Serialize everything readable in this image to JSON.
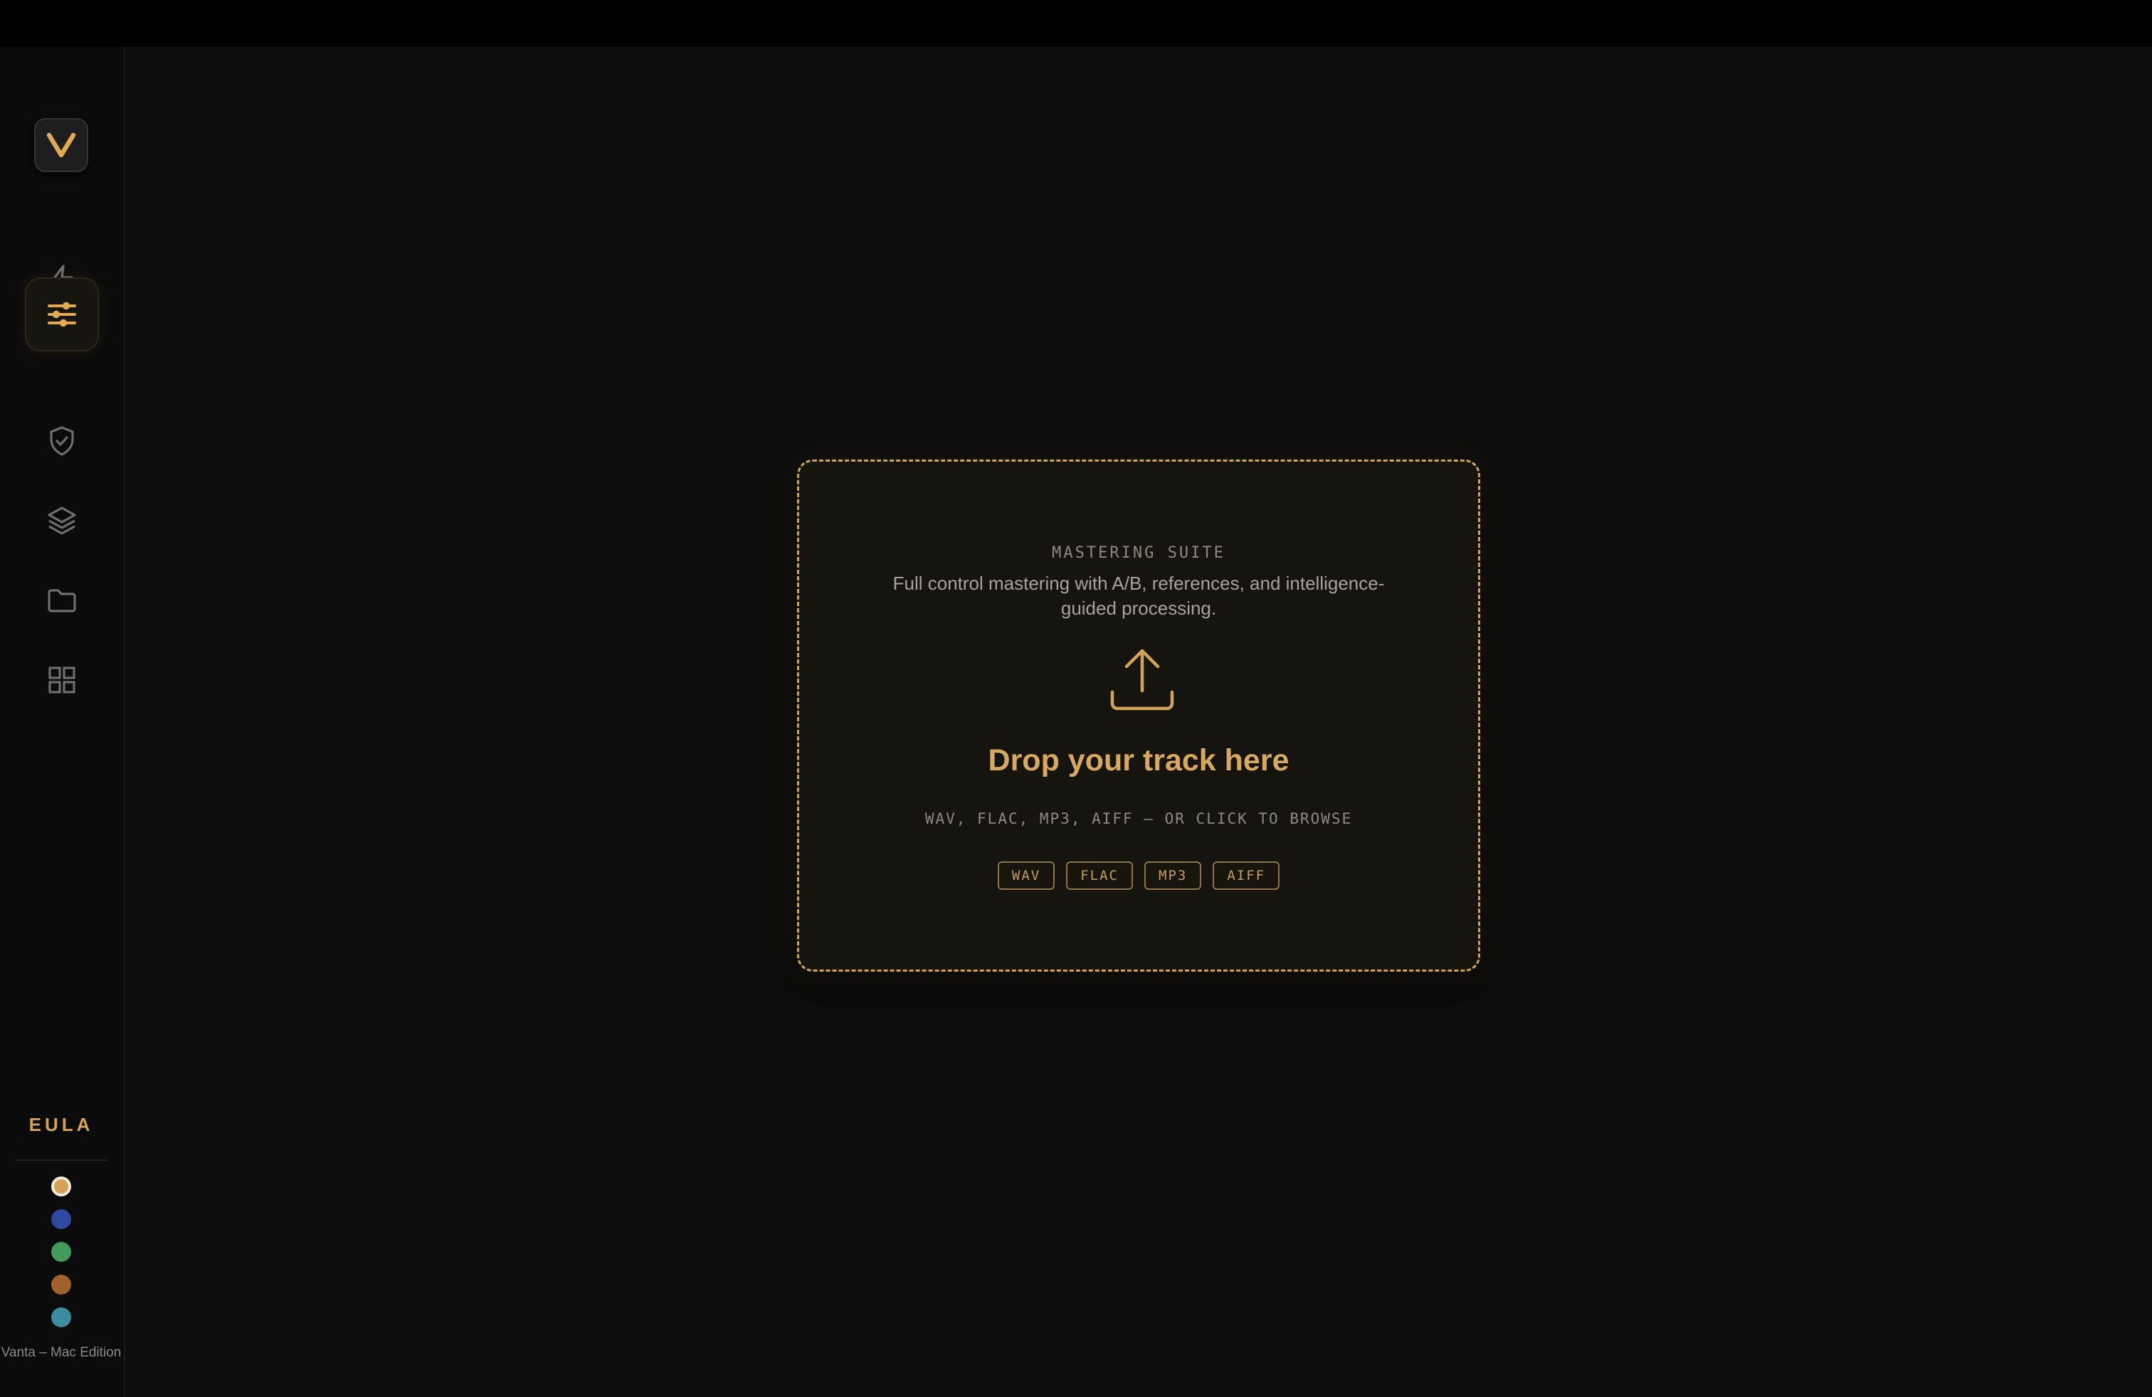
{
  "sidebar": {
    "logo": {
      "icon": "v-logo-icon",
      "letter": "V"
    },
    "items": [
      {
        "id": "quick",
        "icon": "lightning-icon",
        "active": false
      },
      {
        "id": "mastering",
        "icon": "sliders-icon",
        "active": true
      },
      {
        "id": "protection",
        "icon": "shield-check-icon",
        "active": false
      },
      {
        "id": "layers",
        "icon": "layers-icon",
        "active": false
      },
      {
        "id": "files",
        "icon": "folder-icon",
        "active": false
      },
      {
        "id": "apps",
        "icon": "grid-icon",
        "active": false
      }
    ],
    "brand": "EULA",
    "themes": [
      {
        "name": "gold",
        "color": "#d4a257",
        "selected": true
      },
      {
        "name": "blue",
        "color": "#2f4aa0",
        "selected": false
      },
      {
        "name": "green",
        "color": "#3f9c5c",
        "selected": false
      },
      {
        "name": "copper",
        "color": "#a2602a",
        "selected": false
      },
      {
        "name": "teal",
        "color": "#3a8ea0",
        "selected": false
      }
    ],
    "footer": "Vanta – Mac Edition"
  },
  "dropzone": {
    "eyebrow": "MASTERING SUITE",
    "subtitle": "Full control mastering with A/B, references, and intelligence-guided processing.",
    "icon": "upload-icon",
    "headline": "Drop your track here",
    "hint": "WAV, FLAC, MP3, AIFF — OR CLICK TO BROWSE",
    "formats": [
      "WAV",
      "FLAC",
      "MP3",
      "AIFF"
    ]
  },
  "colors": {
    "accent": "#d4a257",
    "background": "#0d0d0d",
    "titlebar": "#000000"
  }
}
